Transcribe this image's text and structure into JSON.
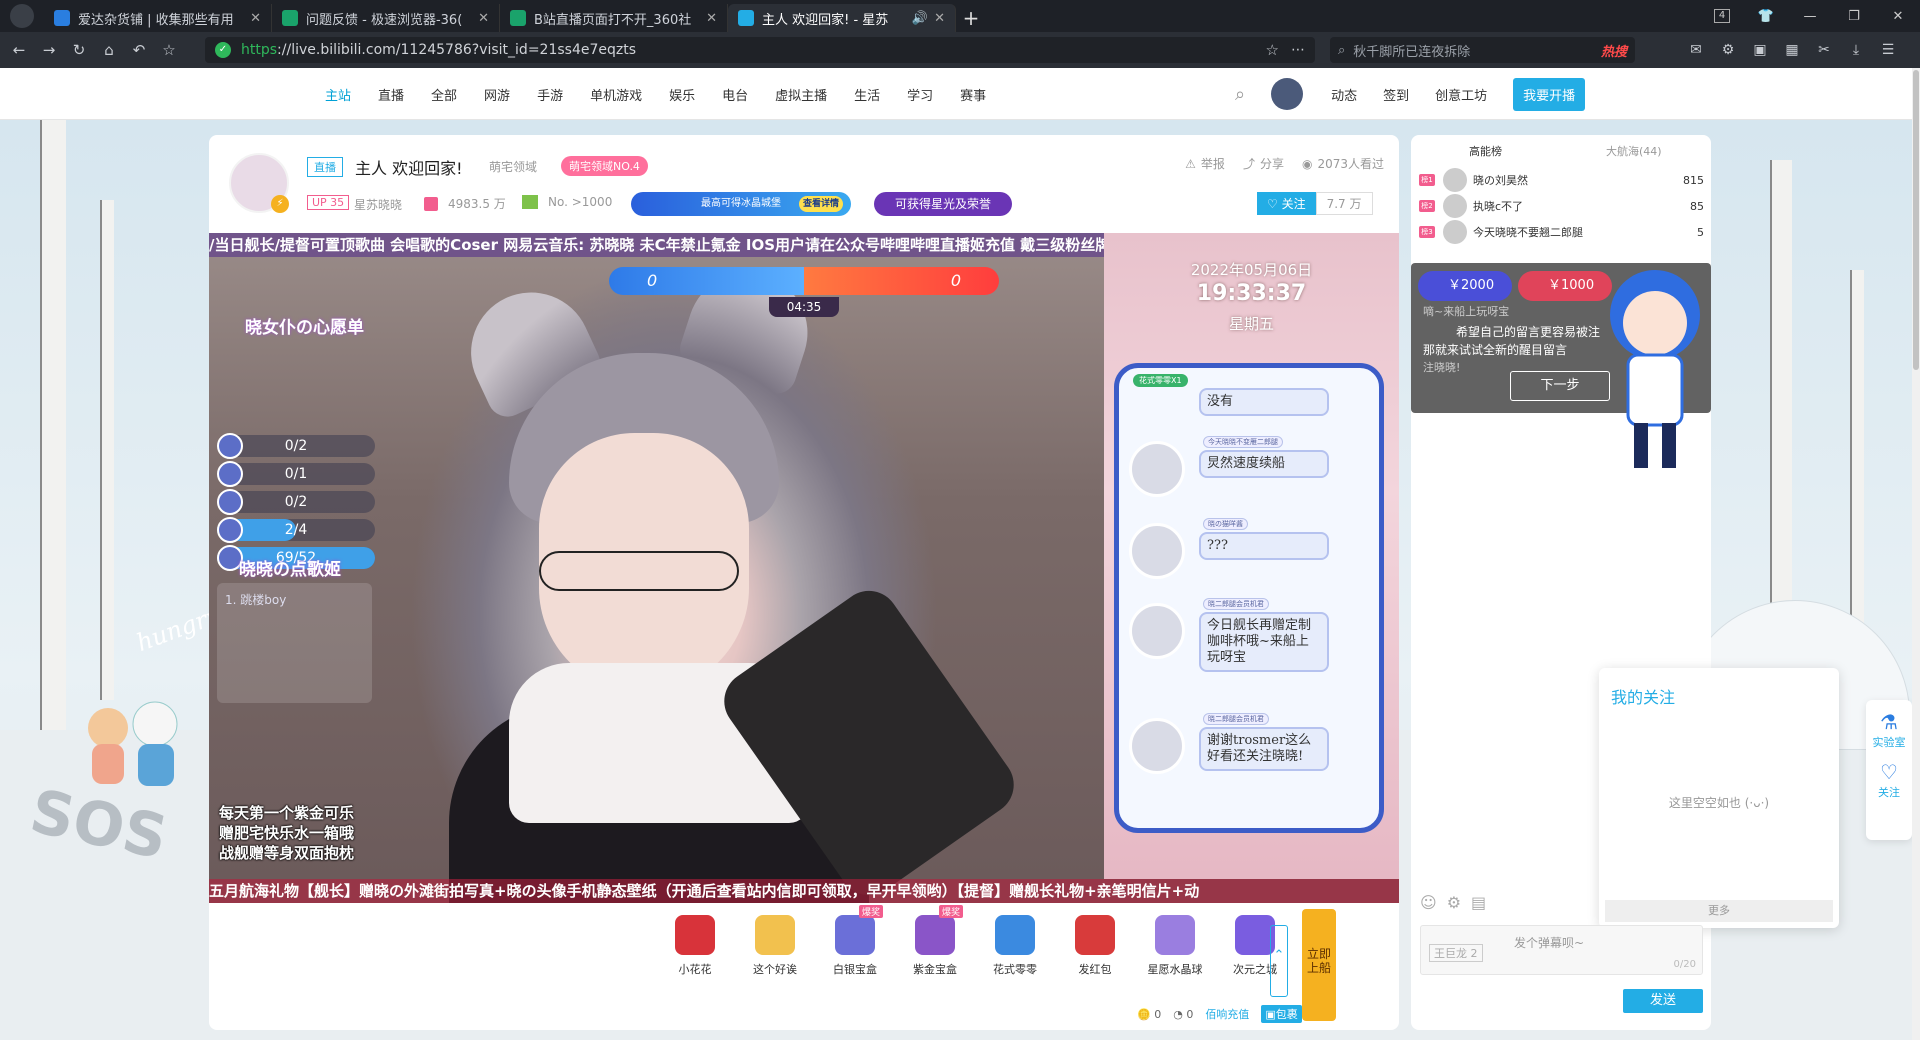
{
  "browser": {
    "tabs": [
      {
        "title": "爱达杂货铺 | 收集那些有用",
        "color": "#2a7ee0"
      },
      {
        "title": "问题反馈 - 极速浏览器-36(",
        "color": "#1aa36b"
      },
      {
        "title": "B站直播页面打不开_360社",
        "color": "#1aa36b"
      },
      {
        "title": "主人 欢迎回家! - 星苏",
        "color": "#23ade5"
      }
    ],
    "tab_count": "4",
    "url_https": "https",
    "url_rest": "://live.bilibili.com/11245786?visit_id=21ss4e7eqzts",
    "search_placeholder": "秋千脚所已连夜拆除",
    "hot_label": "热搜"
  },
  "sitenav": {
    "links": [
      "主站",
      "直播",
      "全部",
      "网游",
      "手游",
      "单机游戏",
      "娱乐",
      "电台",
      "虚拟主播",
      "生活",
      "学习",
      "赛事"
    ],
    "right": [
      "动态",
      "签到",
      "创意工坊"
    ],
    "golive": "我要开播"
  },
  "room": {
    "live_tag": "直播",
    "title": "主人 欢迎回家!",
    "area": "萌宅领域",
    "rank_badge": "萌宅领域NO.4",
    "up_level": "UP 35",
    "streamer": "星苏晓晓",
    "fans": "4983.5 万",
    "rank_no": "No. >1000",
    "ad_text": "最高可得冰晶城堡",
    "ad_button": "查看详情",
    "honor_button": "可获得星光及荣誉",
    "report": "举报",
    "share": "分享",
    "watched": "2073人看过",
    "follow": "关注",
    "follow_count": "7.7 万"
  },
  "player": {
    "marquee_top": "/当日舰长/提督可置顶歌曲    会唱歌的Coser    网易云音乐: 苏晓晓    未C年禁止氪金    IOS用户请在公众号哔哩哔哩直播姬充值    戴三级粉丝牌!",
    "pk_left": "0",
    "pk_right": "0",
    "pk_time": "04:35",
    "wish_title": "晓女仆の心愿单",
    "wishes": [
      {
        "value": "0/2",
        "progress": 0
      },
      {
        "value": "0/1",
        "progress": 0
      },
      {
        "value": "0/2",
        "progress": 0
      },
      {
        "value": "2/4",
        "progress": 0.5
      },
      {
        "value": "69/52",
        "progress": 1
      }
    ],
    "song_title": "晓晓の点歌姬",
    "song_item": "1. 跳楼boy",
    "bubble_lines": [
      "每天第一个紫金可乐",
      "赠肥宅快乐水一箱哦",
      "战舰赠等身双面抱枕"
    ],
    "marquee_bottom": "五月航海礼物【舰长】赠晓の外滩街拍写真+晓の头像手机静态壁纸（开通后查看站内信即可领取，早开早领哟）【提督】赠舰长礼物+亲笔明信片+动",
    "date": "2022年05月06日",
    "time": "19:33:37",
    "weekday": "星期五",
    "card_badge": "花式零零X1",
    "messages": [
      {
        "name": "",
        "text": "没有"
      },
      {
        "name": "今天晓晓不变雁二郎腿",
        "text": "炅然速度续船"
      },
      {
        "name": "晓の猫咩酱",
        "text": "???"
      },
      {
        "name": "晓二郎腿会员机君",
        "text": "今日舰长再赠定制咖啡杯哦~来船上玩呀宝"
      },
      {
        "name": "晓二郎腿会员机君",
        "text": "谢谢trosmer这么好看还关注晓晓!"
      }
    ]
  },
  "gifts": [
    {
      "name": "小花花",
      "color": "#d8333a",
      "hot": ""
    },
    {
      "name": "这个好诶",
      "color": "#f2c14e",
      "hot": ""
    },
    {
      "name": "白银宝盒",
      "color": "#6b6fd8",
      "hot": "爆奖"
    },
    {
      "name": "紫金宝盒",
      "color": "#8a55c8",
      "hot": "爆奖"
    },
    {
      "name": "花式零零",
      "color": "#3b8ae0",
      "hot": ""
    },
    {
      "name": "发红包",
      "color": "#d83b3b",
      "hot": ""
    },
    {
      "name": "星愿水晶球",
      "color": "#9a7ee0",
      "hot": ""
    },
    {
      "name": "次元之城",
      "color": "#7a5de0",
      "hot": ""
    }
  ],
  "board_button": "立即上船",
  "wallet": {
    "gold": "0",
    "silver": "0",
    "recharge": "佰响充值",
    "bag": "包裹"
  },
  "sidebar": {
    "tab_active": "高能榜",
    "tab_other": "大航海(44)",
    "ranks": [
      {
        "no": "榜1",
        "name": "晓の刘昊然",
        "score": "815"
      },
      {
        "no": "榜2",
        "name": "执晓c不了",
        "score": "85"
      },
      {
        "no": "榜3",
        "name": "今天晓晓不要翘二郎腿",
        "score": "5"
      }
    ],
    "guide": {
      "pill1": "￥2000",
      "pill2": "￥1000",
      "line1": "嘀~来船上玩呀宝",
      "line2": "希望自己的留言更容易被注",
      "line3": "那就来试试全新的醒目留言",
      "line4": "注晓晓!",
      "next": "下一步"
    },
    "danmu_badge": "王巨龙",
    "danmu_badge_level": "2",
    "danmu_placeholder": "发个弹幕呗~",
    "danmu_count": "0/20",
    "send": "发送"
  },
  "follow_pop": {
    "title": "我的关注",
    "empty": "这里空空如也 (·ᴗ·)",
    "more": "更多"
  },
  "rightbar": {
    "lab": "实验室",
    "follow": "关注"
  },
  "scene": {
    "hungry": "hungry",
    "sos": "SOS"
  }
}
